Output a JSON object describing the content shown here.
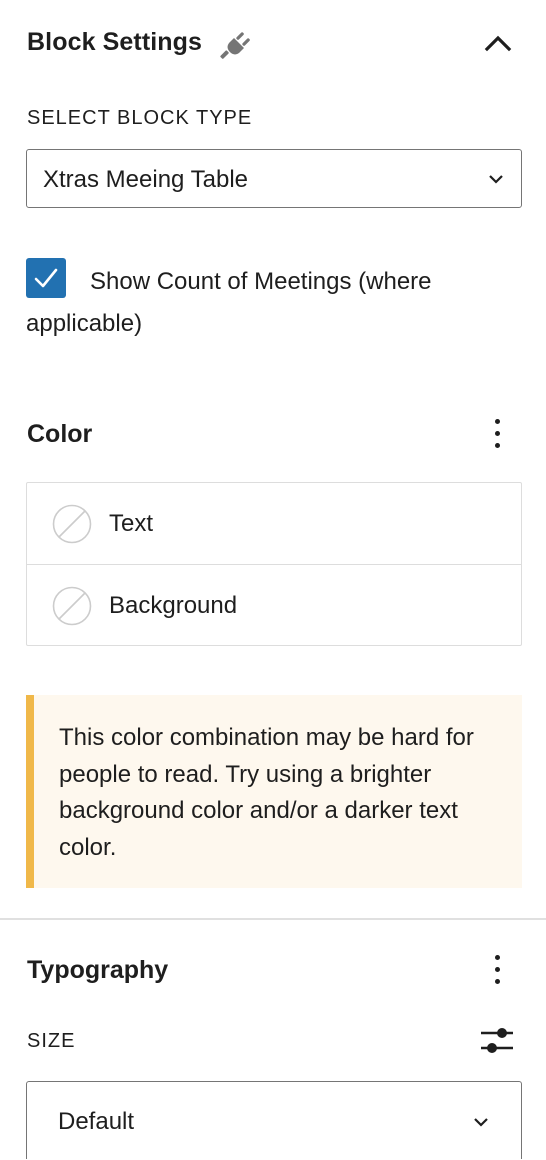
{
  "panel": {
    "title": "Block Settings",
    "title_icon": "plug-icon",
    "collapse_icon": "chevron-up-icon"
  },
  "block_type": {
    "label": "SELECT BLOCK TYPE",
    "selected": "Xtras Meeing Table"
  },
  "show_count": {
    "checked": true,
    "label": "Show Count of Meetings (where applicable)"
  },
  "color": {
    "title": "Color",
    "options_icon": "more-vertical-icon",
    "items": [
      {
        "label": "Text",
        "icon": "no-color-swatch-icon"
      },
      {
        "label": "Background",
        "icon": "no-color-swatch-icon"
      }
    ],
    "notice": "This color combination may be hard for people to read. Try using a brighter background color and/or a darker text color.",
    "notice_accent": "#f0b849",
    "notice_bg": "#fef8ee"
  },
  "typography": {
    "title": "Typography",
    "options_icon": "more-vertical-icon",
    "size_label": "SIZE",
    "size_custom_icon": "sliders-icon",
    "size_selected": "Default"
  },
  "accent_color": "#2271b1"
}
